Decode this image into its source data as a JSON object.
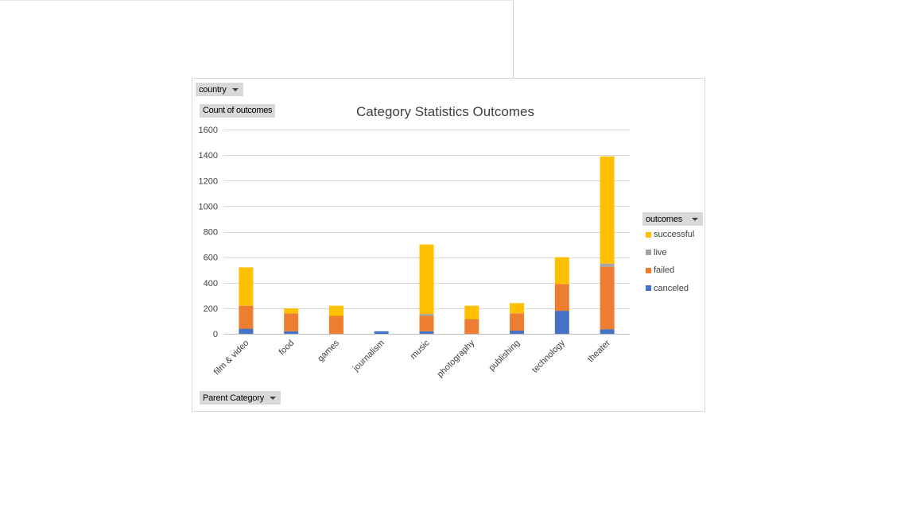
{
  "filters": {
    "country_label": "country",
    "count_label": "Count of outcomes",
    "category_label": "Parent Category",
    "outcomes_label": "outcomes"
  },
  "chart_data": {
    "type": "bar",
    "stacked": true,
    "title": "Category Statistics Outcomes",
    "xlabel": "",
    "ylabel": "",
    "ylim": [
      0,
      1600
    ],
    "yticks": [
      0,
      200,
      400,
      600,
      800,
      1000,
      1200,
      1400,
      1600
    ],
    "grid": true,
    "legend_position": "right",
    "categories": [
      "film & video",
      "food",
      "games",
      "journalism",
      "music",
      "photography",
      "publishing",
      "technology",
      "theater"
    ],
    "series": [
      {
        "name": "canceled",
        "color": "#4472C4",
        "values": [
          40,
          20,
          0,
          20,
          20,
          0,
          25,
          180,
          35
        ]
      },
      {
        "name": "failed",
        "color": "#ED7D31",
        "values": [
          180,
          140,
          140,
          0,
          120,
          115,
          135,
          210,
          490
        ]
      },
      {
        "name": "live",
        "color": "#A5A5A5",
        "values": [
          0,
          0,
          0,
          0,
          15,
          0,
          0,
          0,
          25
        ]
      },
      {
        "name": "successful",
        "color": "#FFC000",
        "values": [
          300,
          40,
          80,
          0,
          545,
          105,
          80,
          210,
          840
        ]
      }
    ]
  }
}
